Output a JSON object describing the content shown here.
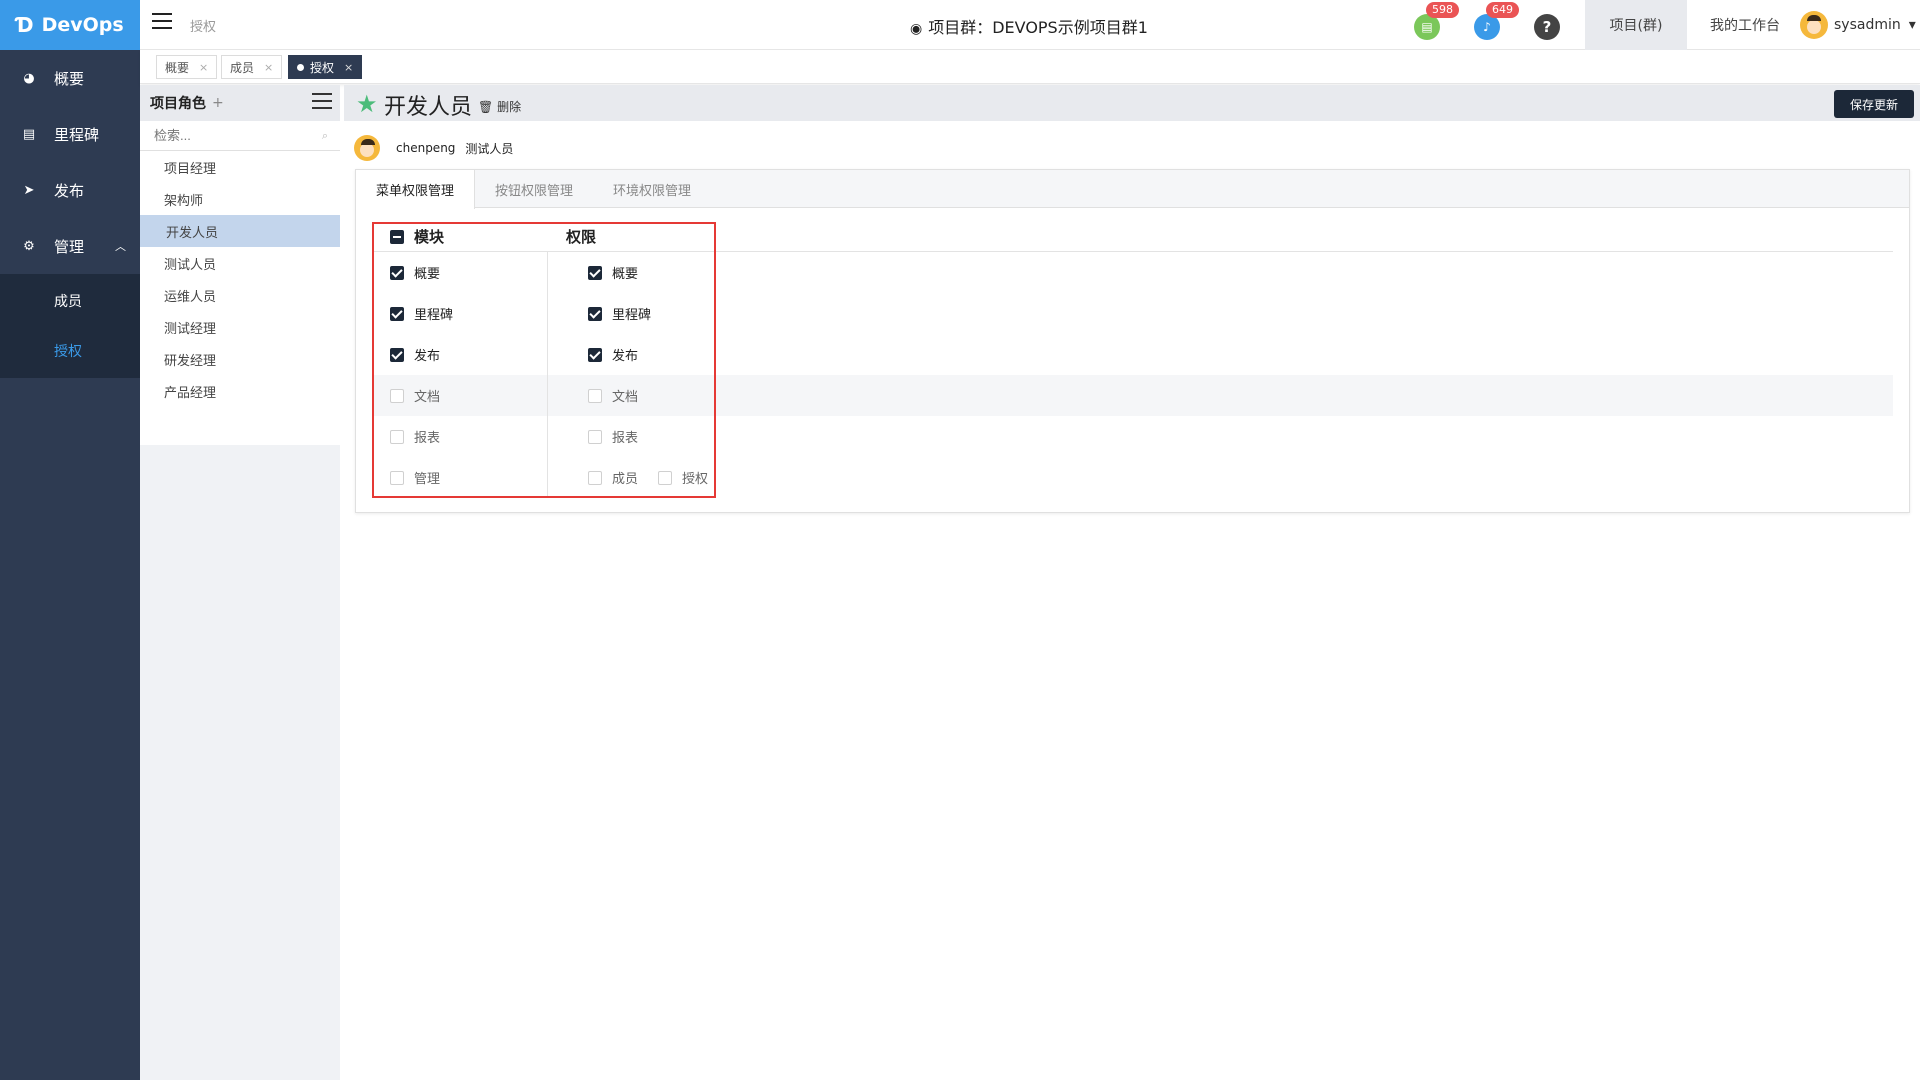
{
  "sidebar": {
    "logo": "DevOps",
    "items": [
      {
        "label": "概要",
        "icon": "dashboard-icon"
      },
      {
        "label": "里程碑",
        "icon": "milestone-icon"
      },
      {
        "label": "发布",
        "icon": "release-icon"
      },
      {
        "label": "管理",
        "icon": "gear-icon"
      }
    ],
    "sub_items": [
      {
        "label": "成员"
      },
      {
        "label": "授权"
      }
    ]
  },
  "header": {
    "breadcrumb": "授权",
    "project_title": "项目群：DEVOPS示例项目群1",
    "notif_green_count": "598",
    "notif_blue_count": "649",
    "help": "?",
    "project_link": "项目(群)",
    "workbench_link": "我的工作台",
    "username": "sysadmin"
  },
  "tabs": [
    {
      "label": "概要"
    },
    {
      "label": "成员"
    },
    {
      "label": "授权"
    }
  ],
  "roles_panel": {
    "title": "项目角色",
    "add": "+",
    "search_placeholder": "检索...",
    "roles": [
      "项目经理",
      "架构师",
      "开发人员",
      "测试人员",
      "运维人员",
      "测试经理",
      "研发经理",
      "产品经理"
    ],
    "selected": "开发人员"
  },
  "main": {
    "role_title": "开发人员",
    "delete_label": "删除",
    "save_label": "保存更新",
    "member_name": "chenpeng",
    "member_role": "测试人员",
    "content_tabs": [
      "菜单权限管理",
      "按钮权限管理",
      "环境权限管理"
    ],
    "active_tab": "菜单权限管理",
    "table": {
      "col_module": "模块",
      "col_permission": "权限",
      "rows": [
        {
          "module": "概要",
          "perm": "概要",
          "checked": true
        },
        {
          "module": "里程碑",
          "perm": "里程碑",
          "checked": true
        },
        {
          "module": "发布",
          "perm": "发布",
          "checked": true
        },
        {
          "module": "文档",
          "perm": "文档",
          "checked": false
        },
        {
          "module": "报表",
          "perm": "报表",
          "checked": false
        },
        {
          "module": "管理",
          "perm": "成员",
          "perm2": "授权",
          "checked": false
        }
      ]
    }
  },
  "colors": {
    "sidebar_bg": "#2e3b52",
    "logo_bg": "#3a9ae8",
    "accent": "#3a9ae8",
    "primary_dark": "#1c2838",
    "star": "#4cbc7a",
    "highlight_box": "#e53935"
  }
}
